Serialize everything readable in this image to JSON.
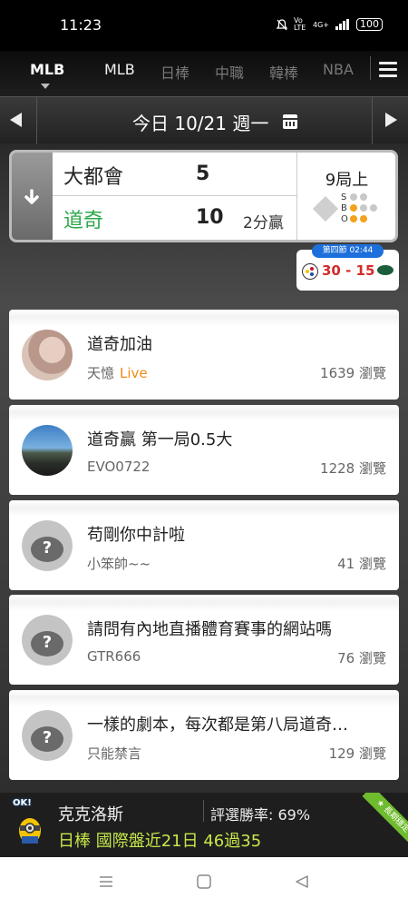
{
  "status_bar": {
    "time": "11:23",
    "icons": [
      "mute-icon",
      "volte-icon",
      "signal-4g-icon",
      "signal-bars-icon",
      "battery-icon"
    ],
    "volte_label": "Vo LTE",
    "network_label": "4G+",
    "battery": "100"
  },
  "tabs": {
    "main": "MLB",
    "items": [
      {
        "label": "MLB"
      },
      {
        "label": "日棒"
      },
      {
        "label": "中職"
      },
      {
        "label": "韓棒"
      },
      {
        "label": "NBA"
      }
    ]
  },
  "date_bar": {
    "label": "今日 10/21 週一"
  },
  "game": {
    "away_team": "大都會",
    "away_score": "5",
    "home_team": "道奇",
    "home_score": "10",
    "result_note": "2分贏",
    "inning": "9局上",
    "sbo": {
      "s": "S",
      "b": "B",
      "o": "O"
    },
    "home_team_color": "#2ea84a"
  },
  "nfl_game": {
    "badge": "第四節 02:44",
    "score": "30 - 15"
  },
  "posts": [
    {
      "title": "道奇加油",
      "author": "天憶",
      "live": "Live",
      "views": "1639 瀏覽",
      "avatar": "photo"
    },
    {
      "title": "道奇贏 第一局0.5大",
      "author": "EVO0722",
      "views": "1228 瀏覽",
      "avatar": "photo"
    },
    {
      "title": "苟剛你中計啦",
      "author": "小笨帥~~",
      "views": "41 瀏覽",
      "avatar": "default"
    },
    {
      "title": "請問有內地直播體育賽事的網站嗎",
      "author": "GTR666",
      "views": "76 瀏覽",
      "avatar": "default"
    },
    {
      "title": "一樣的劇本，每次都是第八局道奇…",
      "author": "只能禁言",
      "views": "129 瀏覽",
      "avatar": "default"
    }
  ],
  "tipster": {
    "mascot_text": "OK!",
    "name": "克克洛斯",
    "win_rate": "評選勝率: 69%",
    "record": "日棒 國際盤近21日 46過35",
    "ribbon": "★ 長期穩定 ★",
    "record_color": "#c6e84a"
  },
  "nav": [
    "menu-icon",
    "home-icon",
    "back-icon"
  ]
}
